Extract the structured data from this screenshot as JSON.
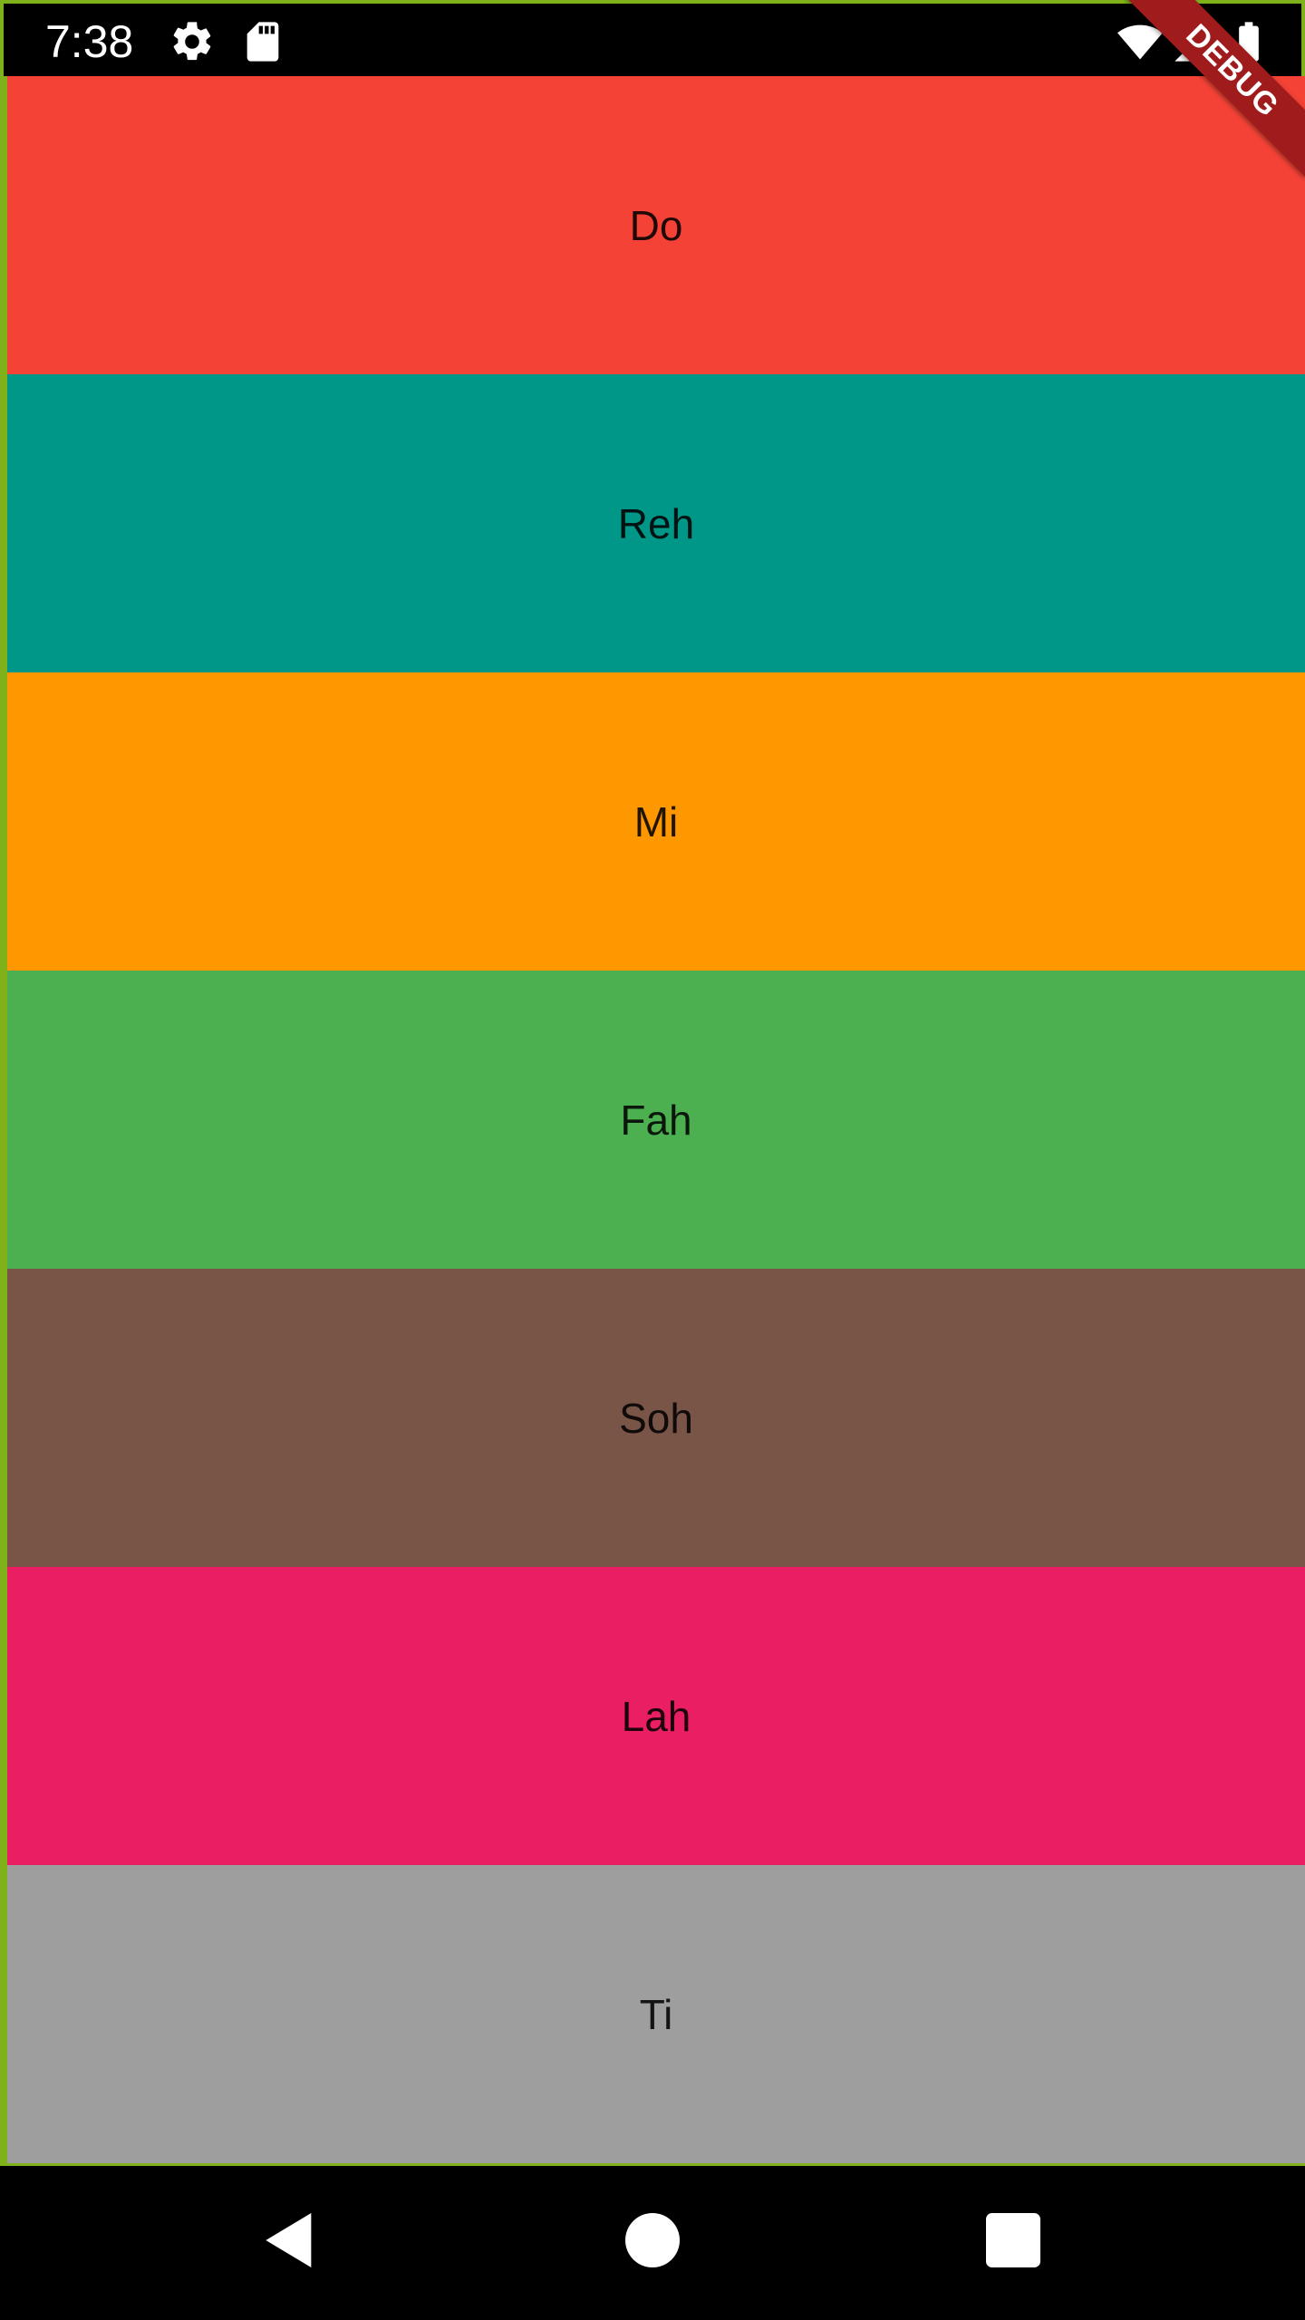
{
  "status_bar": {
    "time": "7:38",
    "icons": [
      "gear-icon",
      "sd-card-icon",
      "wifi-icon",
      "cell-signal-icon",
      "battery-icon"
    ]
  },
  "debug_banner": {
    "label": "DEBUG",
    "color": "#a01c1c"
  },
  "bars": [
    {
      "label": "Do",
      "color": "#f44336"
    },
    {
      "label": "Reh",
      "color": "#009688"
    },
    {
      "label": "Mi",
      "color": "#ff9800"
    },
    {
      "label": "Fah",
      "color": "#4caf50"
    },
    {
      "label": "Soh",
      "color": "#795548"
    },
    {
      "label": "Lah",
      "color": "#e91e63"
    },
    {
      "label": "Ti",
      "color": "#9e9e9e"
    }
  ],
  "nav_bar": {
    "buttons": [
      "back-icon",
      "home-icon",
      "recents-icon"
    ]
  },
  "accent_border_color": "#7fb21a"
}
